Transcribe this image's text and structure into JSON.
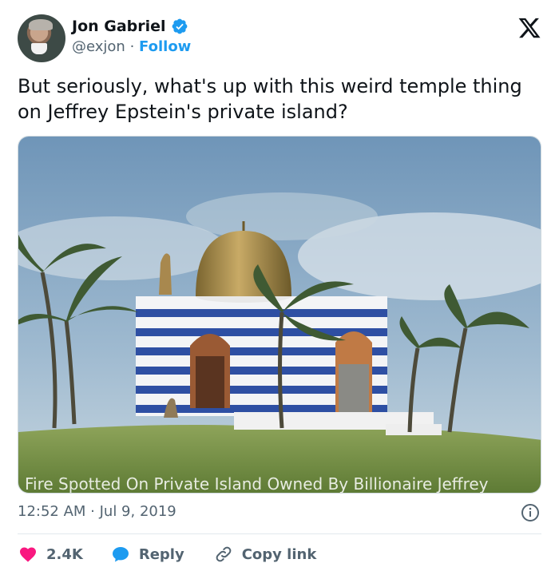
{
  "author": {
    "display_name": "Jon Gabriel",
    "handle": "@exjon",
    "separator": "·",
    "follow_label": "Follow",
    "verified": true
  },
  "tweet": {
    "text": "But seriously, what's up with this weird temple thing on Jeffrey Epstein's private island?",
    "image_caption_fragment": "Fire Spotted On Private Island Owned By Billionaire Jeffrey",
    "timestamp": "12:52 AM · Jul 9, 2019"
  },
  "actions": {
    "likes": "2.4K",
    "reply": "Reply",
    "copy_link": "Copy link"
  },
  "icons": {
    "brand": "x-logo-icon",
    "verified": "verified-badge-icon",
    "info": "info-icon",
    "like": "heart-icon",
    "reply": "reply-bubble-icon",
    "copy": "link-icon"
  },
  "colors": {
    "accent": "#1d9bf0",
    "like": "#f91880",
    "text": "#0f1419",
    "muted": "#536471"
  }
}
